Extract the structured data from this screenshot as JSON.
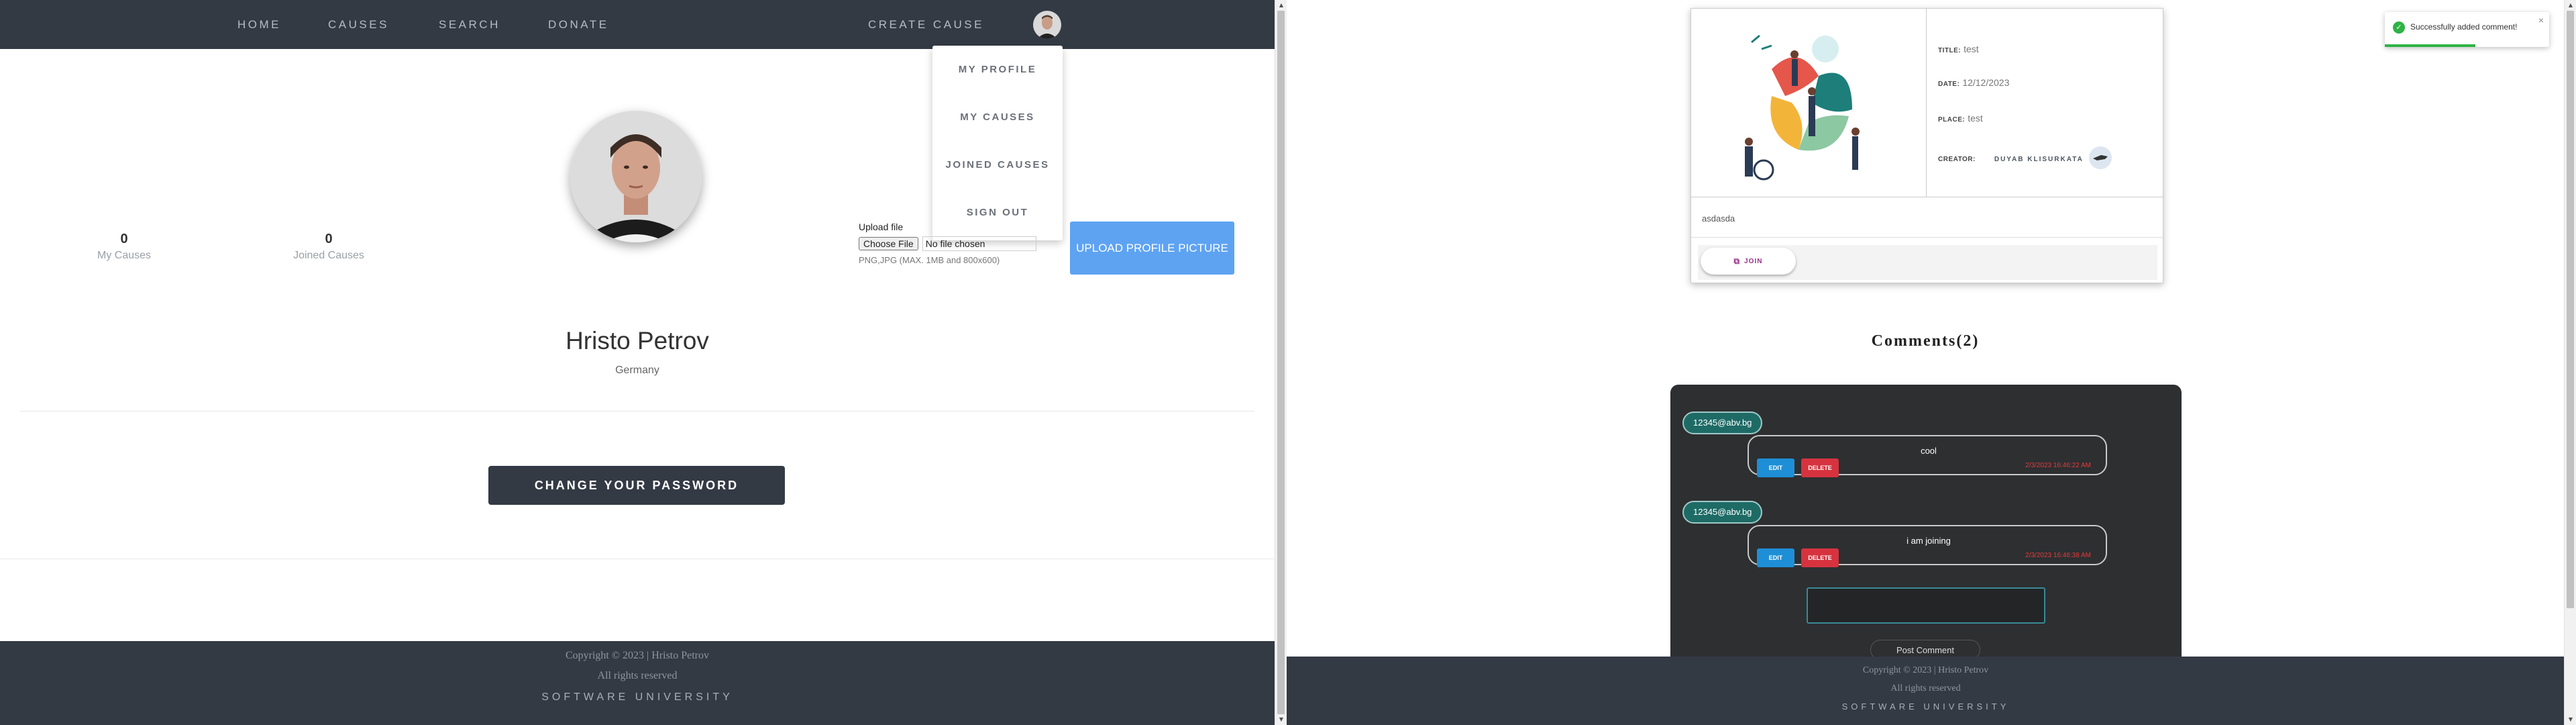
{
  "left": {
    "nav": {
      "home": "HOME",
      "causes": "CAUSES",
      "search": "SEARCH",
      "donate": "DONATE",
      "create_cause": "CREATE CAUSE"
    },
    "dropdown": [
      "MY PROFILE",
      "MY CAUSES",
      "JOINED CAUSES",
      "SIGN OUT"
    ],
    "stats": {
      "my_causes": {
        "count": "0",
        "label": "My Causes"
      },
      "joined_causes": {
        "count": "0",
        "label": "Joined Causes"
      }
    },
    "upload": {
      "label": "Upload file",
      "choose_button": "Choose File",
      "file_name": "No file chosen",
      "hint": "PNG,JPG (MAX. 1MB and 800x600)",
      "submit_label": "UPLOAD PROFILE PICTURE"
    },
    "profile": {
      "name": "Hristo Petrov",
      "country": "Germany"
    },
    "change_password_label": "CHANGE YOUR PASSWORD",
    "footer": {
      "copyright": "Copyright © 2023 | Hristo Petrov",
      "rights": "All rights reserved",
      "org": "SOFTWARE UNIVERSITY"
    }
  },
  "right": {
    "cause": {
      "title_label": "TITLE:",
      "title": "test",
      "date_label": "DATE:",
      "date": "12/12/2023",
      "place_label": "PLACE:",
      "place": "test",
      "creator_label": "CREATOR:",
      "creator": "DUYAB KLISURKATA",
      "description": "asdasda",
      "join_label": "JOIN"
    },
    "comments_title": "Comments(2)",
    "comments": [
      {
        "user": "12345@abv.bg",
        "text": "cool",
        "date": "2/3/2023 16:46:22 AM",
        "edit": "EDIT",
        "delete": "DELETE"
      },
      {
        "user": "12345@abv.bg",
        "text": "i am joining",
        "date": "2/3/2023 16:46:38 AM",
        "edit": "EDIT",
        "delete": "DELETE"
      }
    ],
    "post_comment_label": "Post Comment",
    "toast": {
      "message": "Successfully added comment!",
      "progress": 0.55
    },
    "footer": {
      "copyright": "Copyright © 2023 | Hristo Petrov",
      "rights": "All rights reserved",
      "org": "SOFTWARE UNIVERSITY"
    }
  },
  "colors": {
    "navbar": "#333a44",
    "upload_button": "#5ea3f2",
    "edit": "#1e8fd6",
    "delete": "#d6333f",
    "toast_success": "#2fb344"
  }
}
